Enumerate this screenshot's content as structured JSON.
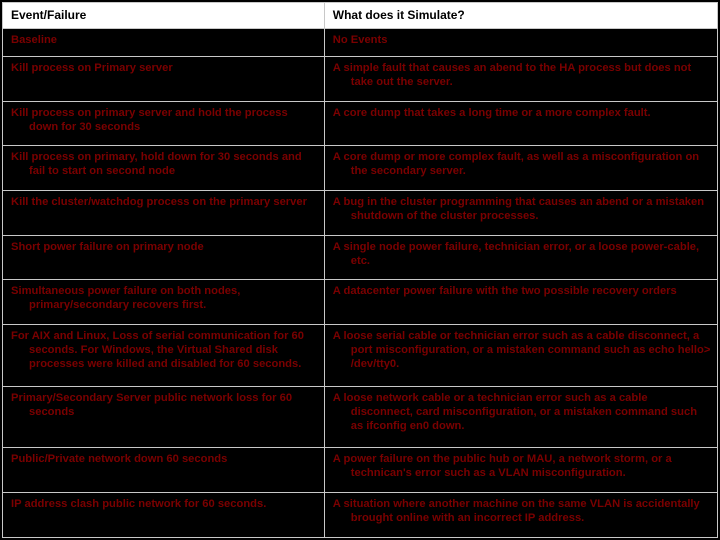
{
  "table": {
    "headers": {
      "col1": "Event/Failure",
      "col2": "What does it Simulate?"
    },
    "rows": [
      {
        "event": "Baseline",
        "sim": "No Events"
      },
      {
        "event": "Kill process on Primary server",
        "sim": "A simple fault that causes an abend to the HA process but does not take out the server."
      },
      {
        "event": "Kill process on primary server and hold the process down for 30 seconds",
        "sim": "A core dump that takes a long time or a more complex fault."
      },
      {
        "event": "Kill process on primary, hold down for 30 seconds and fail to start on second node",
        "sim": "A core dump or more complex fault, as well as a misconfiguration on the secondary server."
      },
      {
        "event": "Kill the cluster/watchdog process on the primary server",
        "sim": "A bug in the cluster programming that causes an abend or a mistaken shutdown of the cluster processes."
      },
      {
        "event": "Short power failure on primary node",
        "sim": "A single node power failure, technician error, or a loose power-cable, etc."
      },
      {
        "event": "Simultaneous power failure on both nodes, primary/secondary recovers first.",
        "sim": "A datacenter power failure with the two possible recovery orders"
      },
      {
        "event": "For AIX and Linux, Loss of serial communication for 60 seconds. For Windows, the Virtual Shared disk processes were killed and disabled for 60 seconds.",
        "sim": "A loose serial cable or technician error such as a cable disconnect, a port misconfiguration, or a mistaken command such as echo hello> /dev/tty0."
      },
      {
        "event": "Primary/Secondary Server public network loss for 60 seconds",
        "sim": "A loose network cable or a technician error such as a cable disconnect, card misconfiguration, or a mistaken command such as ifconfig en0 down."
      },
      {
        "event": "Public/Private network down 60 seconds",
        "sim": "A power failure on the public hub or MAU, a network storm, or a technican's error such as a VLAN misconfiguration."
      },
      {
        "event": "IP address clash public network for 60 seconds.",
        "sim": "A situation where another machine on the same VLAN is accidentally brought online with an incorrect IP address."
      }
    ]
  }
}
